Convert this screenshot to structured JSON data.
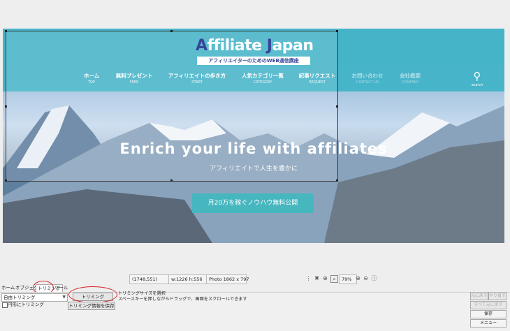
{
  "website": {
    "logo_text_main": "Affiliate Japan",
    "logo_subtitle": "アフィリエイターのためのWEB通信講座",
    "nav": [
      {
        "jp": "ホーム",
        "en": "TOP"
      },
      {
        "jp": "無料プレゼント",
        "en": "FREE"
      },
      {
        "jp": "アフィリエイトの歩き方",
        "en": "START"
      },
      {
        "jp": "人気カテゴリ一覧",
        "en": "CATEGORY"
      },
      {
        "jp": "記事リクエスト",
        "en": "REQUEST"
      },
      {
        "jp": "お問い合わせ",
        "en": "CONTACT US"
      },
      {
        "jp": "会社概要",
        "en": "COMPANY"
      }
    ],
    "search_label": "search",
    "hero_title": "Enrich your life with affiliates",
    "hero_subtitle": "アフィリエイトで人生を豊かに",
    "cta_label": "月20万を稼ぐノウハウ無料公開",
    "colors": {
      "band": "#3fb3c7",
      "logo_accent": "#1a2e8c",
      "cta": "#46b6bf"
    }
  },
  "status_bar": {
    "cursor": "(1748,551)",
    "selection_size": "w:1226 h:556",
    "photo_size": "Photo 1862 x 797",
    "zoom": "79%"
  },
  "tabs": [
    {
      "label": "ホーム"
    },
    {
      "label": "オブジェクト"
    },
    {
      "label": "トリミング",
      "active": true
    },
    {
      "label": "ツール"
    }
  ],
  "trim_panel": {
    "mode_select": "自由トリミング",
    "circle_trim_label": "円形にトリミング",
    "trim_button": "トリミング",
    "save_info_button": "トリミング情報を保存",
    "help_line1": "トリミングサイズを選択",
    "help_line2": "スペースキーを押しながらドラッグで、画面をスクロールできます"
  },
  "right_buttons": {
    "undo": "元に戻す",
    "redo": "やり直す",
    "undo_all": "すべて元に戻す",
    "save": "保存",
    "menu": "メニュー"
  }
}
